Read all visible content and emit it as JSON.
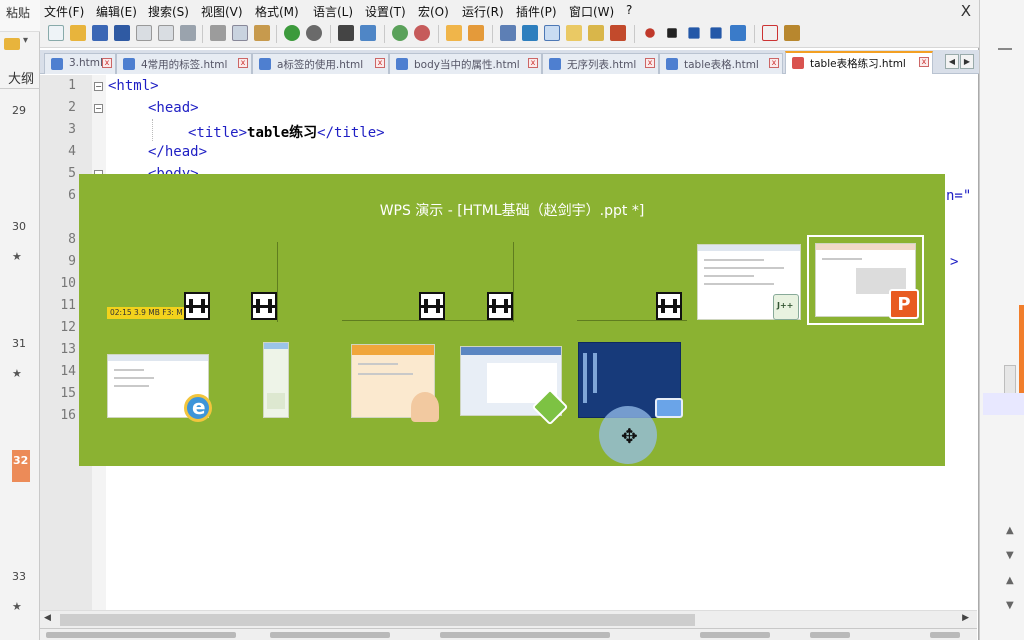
{
  "background_window": {
    "paste_label": "粘贴",
    "outline_label": "大纲",
    "slides": [
      {
        "num": "29",
        "star": ""
      },
      {
        "num": "30",
        "star": "★"
      },
      {
        "num": "31",
        "star": "★"
      },
      {
        "num": "32",
        "star": ""
      },
      {
        "num": "33",
        "star": "★"
      }
    ],
    "accent_color": "#f17e2b"
  },
  "editor": {
    "menu": [
      "文件(F)",
      "编辑(E)",
      "搜索(S)",
      "视图(V)",
      "格式(M)",
      "语言(L)",
      "设置(T)",
      "宏(O)",
      "运行(R)",
      "插件(P)",
      "窗口(W)",
      "?"
    ],
    "close_glyph": "X",
    "tabs": [
      {
        "label": "3.html",
        "active": false
      },
      {
        "label": "4常用的标签.html",
        "active": false
      },
      {
        "label": "a标签的使用.html",
        "active": false
      },
      {
        "label": "body当中的属性.html",
        "active": false
      },
      {
        "label": "无序列表.html",
        "active": false
      },
      {
        "label": "table表格.html",
        "active": false
      },
      {
        "label": "table表格练习.html",
        "active": true
      }
    ],
    "line_numbers": [
      "1",
      "2",
      "3",
      "4",
      "5",
      "6",
      "7",
      "8",
      "9",
      "10",
      "11",
      "12",
      "13",
      "14",
      "15",
      "16"
    ],
    "code": {
      "l1": "<html>",
      "l2": "<head>",
      "l3_open": "<title>",
      "l3_text": "table练习",
      "l3_close": "</title>",
      "l4": "</head>",
      "l5": "<body>",
      "l6_tail": "n=\"",
      "l9_tail": ">"
    }
  },
  "switcher": {
    "title": "WPS 演示 - [HTML基础（赵剑宇）.ppt *]",
    "media_info": "02:15    3.9 MB    F3: M",
    "ppt_badge": "P",
    "color": "#8bb232"
  }
}
